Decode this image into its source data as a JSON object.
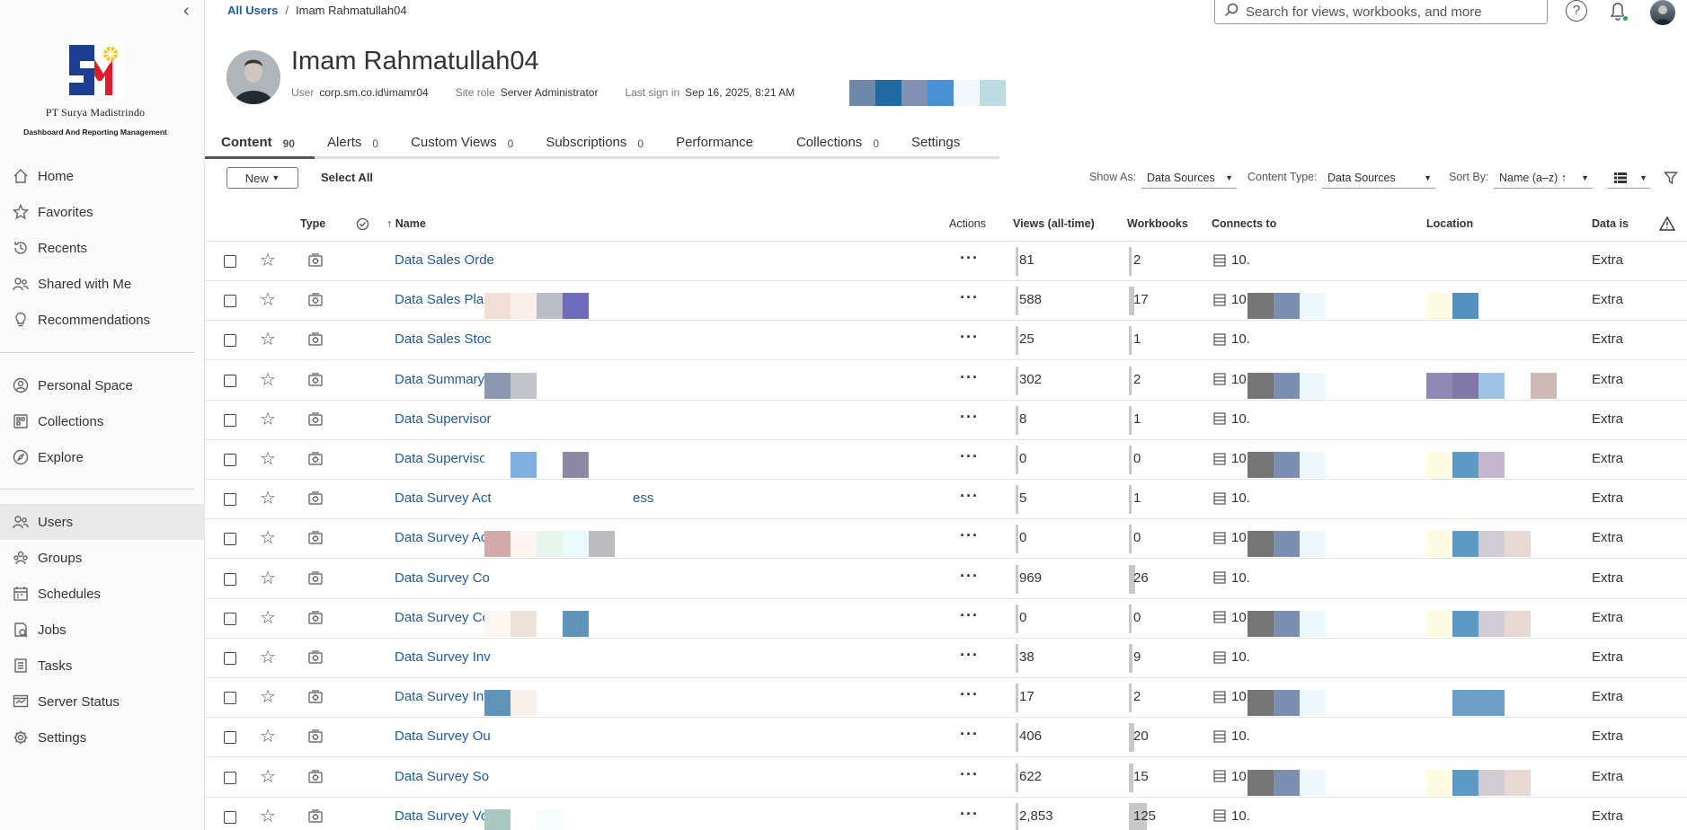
{
  "breadcrumb": {
    "root": "All Users",
    "separator": "/",
    "current": "Imam Rahmatullah04"
  },
  "company": {
    "name": "PT Surya Madistrindo",
    "tagline": "Dashboard And Reporting Management"
  },
  "search": {
    "placeholder": "Search for views, workbooks, and more"
  },
  "sidebar": {
    "group1": [
      {
        "label": "Home",
        "icon": "home-icon"
      },
      {
        "label": "Favorites",
        "icon": "star-icon"
      },
      {
        "label": "Recents",
        "icon": "history-icon"
      },
      {
        "label": "Shared with Me",
        "icon": "shared-icon"
      },
      {
        "label": "Recommendations",
        "icon": "bulb-icon"
      }
    ],
    "group2": [
      {
        "label": "Personal Space",
        "icon": "person-icon"
      },
      {
        "label": "Collections",
        "icon": "collections-icon"
      },
      {
        "label": "Explore",
        "icon": "compass-icon"
      }
    ],
    "group3": [
      {
        "label": "Users",
        "icon": "users-icon"
      },
      {
        "label": "Groups",
        "icon": "groups-icon"
      },
      {
        "label": "Schedules",
        "icon": "calendar-icon"
      },
      {
        "label": "Jobs",
        "icon": "jobs-icon"
      },
      {
        "label": "Tasks",
        "icon": "tasks-icon"
      },
      {
        "label": "Server Status",
        "icon": "server-status-icon"
      },
      {
        "label": "Settings",
        "icon": "gear-icon"
      }
    ]
  },
  "profile": {
    "name": "Imam Rahmatullah04",
    "user_label": "User",
    "user_value": "corp.sm.co.id\\imamr04",
    "role_label": "Site role",
    "role_value": "Server Administrator",
    "signin_label": "Last sign in",
    "signin_value": "Sep 16, 2025, 8:21 AM"
  },
  "tabs": [
    {
      "label": "Content",
      "count": "90"
    },
    {
      "label": "Alerts",
      "count": "0"
    },
    {
      "label": "Custom Views",
      "count": "0"
    },
    {
      "label": "Subscriptions",
      "count": "0"
    },
    {
      "label": "Performance",
      "count": ""
    },
    {
      "label": "Collections",
      "count": "0"
    },
    {
      "label": "Settings",
      "count": ""
    }
  ],
  "toolbar": {
    "new_label": "New",
    "select_all": "Select All",
    "show_as_label": "Show As:",
    "show_as_value": "Data Sources",
    "content_type_label": "Content Type:",
    "content_type_value": "Data Sources",
    "sort_by_label": "Sort By:",
    "sort_by_value": "Name (a–z) ↑"
  },
  "columns": {
    "type": "Type",
    "name": "↑ Name",
    "actions": "Actions",
    "views": "Views (all-time)",
    "workbooks": "Workbooks",
    "connects": "Connects to",
    "location": "Location",
    "data_is": "Data is"
  },
  "rows": [
    {
      "name": "Data Sales Orde",
      "views": "81",
      "workbooks": "2",
      "connects": "10.",
      "data": "Extra"
    },
    {
      "name": "Data Sales Plan",
      "views": "588",
      "workbooks": "17",
      "connects": "10.",
      "data": "Extra"
    },
    {
      "name": "Data Sales Stoc",
      "views": "25",
      "workbooks": "1",
      "connects": "10.",
      "data": "Extra"
    },
    {
      "name": "Data Summary",
      "views": "302",
      "workbooks": "2",
      "connects": "10.",
      "data": "Extra"
    },
    {
      "name": "Data Supervisor",
      "views": "8",
      "workbooks": "1",
      "connects": "10.",
      "data": "Extra"
    },
    {
      "name": "Data Supervisor",
      "views": "0",
      "workbooks": "0",
      "connects": "10.",
      "data": "Extra"
    },
    {
      "name": "Data Survey Act",
      "name_tail": "ess",
      "views": "5",
      "workbooks": "1",
      "connects": "10.",
      "data": "Extra"
    },
    {
      "name": "Data Survey Act",
      "views": "0",
      "workbooks": "0",
      "connects": "10.",
      "data": "Extra"
    },
    {
      "name": "Data Survey Co",
      "views": "969",
      "workbooks": "26",
      "connects": "10.",
      "data": "Extra"
    },
    {
      "name": "Data Survey Co",
      "views": "0",
      "workbooks": "0",
      "connects": "10.",
      "data": "Extra"
    },
    {
      "name": "Data Survey Inv",
      "views": "38",
      "workbooks": "9",
      "connects": "10.",
      "data": "Extra"
    },
    {
      "name": "Data Survey Inv",
      "views": "17",
      "workbooks": "2",
      "connects": "10.",
      "data": "Extra"
    },
    {
      "name": "Data Survey Ou",
      "views": "406",
      "workbooks": "20",
      "connects": "10.",
      "data": "Extra"
    },
    {
      "name": "Data Survey So",
      "views": "622",
      "workbooks": "15",
      "connects": "10.",
      "data": "Extra"
    },
    {
      "name": "Data Survey Vol",
      "views": "2,853",
      "workbooks": "125",
      "connects": "10.",
      "data": "Extra"
    }
  ],
  "colors": {
    "link": "#1f5b9c",
    "brand_red": "#d81e2c",
    "brand_blue": "#1d3f8f",
    "online": "#2aa24a"
  }
}
